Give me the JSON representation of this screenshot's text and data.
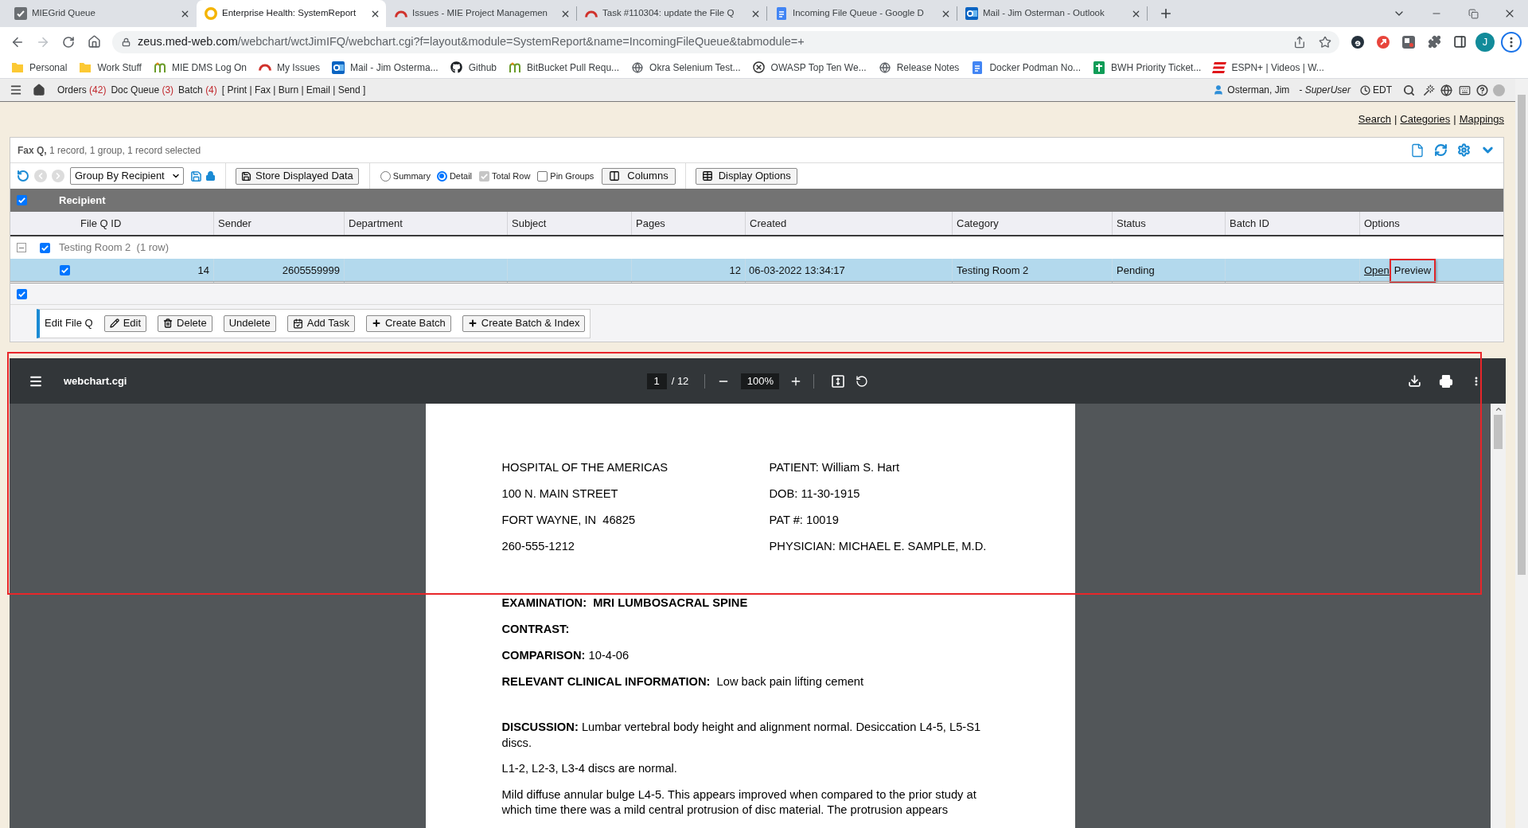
{
  "browser": {
    "tabs": [
      {
        "title": "MIEGrid Queue",
        "selected": false
      },
      {
        "title": "Enterprise Health: SystemReport",
        "selected": true
      },
      {
        "title": "Issues - MIE Project Managemen",
        "selected": false
      },
      {
        "title": "Task #110304: update the File Q",
        "selected": false
      },
      {
        "title": "Incoming File Queue - Google D",
        "selected": false
      },
      {
        "title": "Mail - Jim Osterman - Outlook",
        "selected": false
      }
    ],
    "url": {
      "host": "zeus.med-web.com",
      "path": "/webchart/wctJimIFQ/webchart.cgi?f=layout&module=SystemReport&name=IncomingFileQueue&tabmodule=+"
    },
    "profile_initial": "J",
    "bookmarks": [
      "Personal",
      "Work Stuff",
      "MIE DMS Log On",
      "My Issues",
      "Mail - Jim Osterma...",
      "Github",
      "BitBucket Pull Requ...",
      "Okra Selenium Test...",
      "OWASP Top Ten We...",
      "Release Notes",
      "Docker Podman No...",
      "BWH Priority Ticket...",
      "ESPN+ | Videos | W..."
    ]
  },
  "app_nav": {
    "items": [
      {
        "label": "Orders",
        "count": "(42)"
      },
      {
        "label": "Doc Queue",
        "count": "(3)"
      },
      {
        "label": "Batch",
        "count": "(4)"
      }
    ],
    "batch_actions": "[ Print | Fax | Burn | Email | Send ]",
    "user": "Osterman, Jim",
    "role": "- SuperUser",
    "timezone": "EDT"
  },
  "page_links": {
    "items": [
      "Search",
      "Categories",
      "Mappings"
    ],
    "separator": "|"
  },
  "panel": {
    "title": "Fax Q,",
    "summary": "1 record, 1 group, 1 record selected",
    "toolbar": {
      "group_by": "Group By Recipient",
      "store_button": "Store Displayed Data",
      "view_options": [
        {
          "label": "Summary",
          "selected": false
        },
        {
          "label": "Detail",
          "selected": true
        }
      ],
      "toggles": [
        {
          "label": "Total Row",
          "checked": true,
          "disabled": true
        },
        {
          "label": "Pin Groups",
          "checked": false,
          "disabled": false
        }
      ],
      "columns_button": "Columns",
      "display_options_button": "Display Options"
    },
    "recipient": {
      "label": "Recipient",
      "checked": true
    },
    "table": {
      "columns": [
        "File Q ID",
        "Sender",
        "Department",
        "Subject",
        "Pages",
        "Created",
        "Category",
        "Status",
        "Batch ID",
        "Options"
      ],
      "groups": [
        {
          "label": "Testing Room 2",
          "count": "(1 row)",
          "checked": true,
          "expanded": true,
          "rows": [
            {
              "checked": true,
              "selected": true,
              "file_q_id": "14",
              "sender": "2605559999",
              "pages": "12",
              "created": "06-03-2022 13:34:17",
              "category": "Testing Room 2",
              "status": "Pending",
              "options": [
                {
                  "label": "Open",
                  "kind": "link",
                  "highlighted": false
                },
                {
                  "label": "Preview",
                  "kind": "text",
                  "highlighted": true
                }
              ]
            }
          ]
        }
      ]
    },
    "footer": {
      "checked": true
    },
    "actions": {
      "label": "Edit File Q",
      "buttons": [
        "Edit",
        "Delete",
        "Undelete",
        "Add Task",
        "Create Batch",
        "Create Batch & Index"
      ]
    }
  },
  "pdf_viewer": {
    "file_name": "webchart.cgi",
    "page": "1",
    "page_separator": "/",
    "page_count": "12",
    "zoom": "100%",
    "document": {
      "header_left": [
        "HOSPITAL OF THE AMERICAS",
        "100 N. MAIN STREET",
        "FORT WAYNE, IN  46825",
        "260-555-1212"
      ],
      "header_right": [
        "PATIENT: William S. Hart",
        "DOB: 11-30-1915",
        "PAT #: 10019",
        "PHYSICIAN: MICHAEL E. SAMPLE, M.D."
      ],
      "fields": [
        {
          "kind": "heading",
          "text": "EXAMINATION:  MRI LUMBOSACRAL SPINE"
        },
        {
          "kind": "heading",
          "text": "CONTRAST:"
        },
        {
          "kind": "field",
          "text": "**COMPARISON:** 10-4-06"
        },
        {
          "kind": "field",
          "text": "**RELEVANT CLINICAL INFORMATION:**  Low back pain lifting cement"
        }
      ],
      "discussion": [
        "**DISCUSSION:** Lumbar vertebral body height and alignment normal. Desiccation L4-5, L5-S1 discs.",
        "L1-2, L2-3, L3-4 discs are normal.",
        "Mild diffuse annular bulge L4-5. This appears improved when compared to the prior study at which time there was a mild central protrusion of disc material. The protrusion appears"
      ]
    }
  }
}
